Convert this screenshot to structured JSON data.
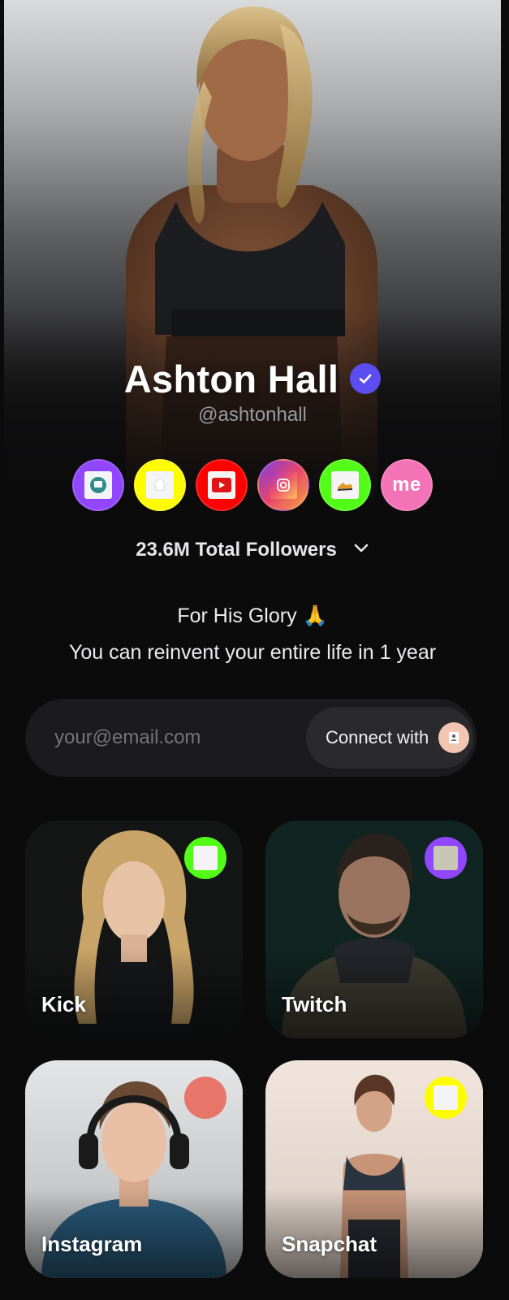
{
  "profile": {
    "name": "Ashton Hall",
    "handle": "@ashtonhall",
    "verified": true
  },
  "socials": [
    {
      "name": "twitch",
      "color": "#9146ff",
      "icon": "twitch-icon"
    },
    {
      "name": "snapchat",
      "color": "#fffc00",
      "icon": "snapchat-icon"
    },
    {
      "name": "youtube",
      "color": "#ff0000",
      "icon": "youtube-icon"
    },
    {
      "name": "instagram",
      "color": "#c13584",
      "icon": "instagram-icon"
    },
    {
      "name": "kick",
      "color": "#53fc18",
      "icon": "kick-icon"
    },
    {
      "name": "me",
      "color": "#f472b6",
      "label": "me"
    }
  ],
  "followers": {
    "text": "23.6M Total Followers",
    "icon": "chevron-down-icon"
  },
  "bio": {
    "line1": "For His Glory 🙏",
    "line2": "You can reinvent your entire life in 1 year"
  },
  "connect": {
    "placeholder": "your@email.com",
    "button_label": "Connect with",
    "icon": "user-icon"
  },
  "cards": [
    {
      "label": "Kick",
      "badge_color": "#53fc18",
      "icon": "kick-icon"
    },
    {
      "label": "Twitch",
      "badge_color": "#9146ff",
      "icon": "twitch-icon"
    },
    {
      "label": "Instagram",
      "badge_color": "#e8756a",
      "icon": "instagram-icon"
    },
    {
      "label": "Snapchat",
      "badge_color": "#fffc00",
      "icon": "snapchat-icon"
    }
  ],
  "colors": {
    "background": "#0b0b0c",
    "verified": "#5b4df0",
    "input_bg": "#1b1b1d",
    "button_bg": "#2a2a2d"
  }
}
